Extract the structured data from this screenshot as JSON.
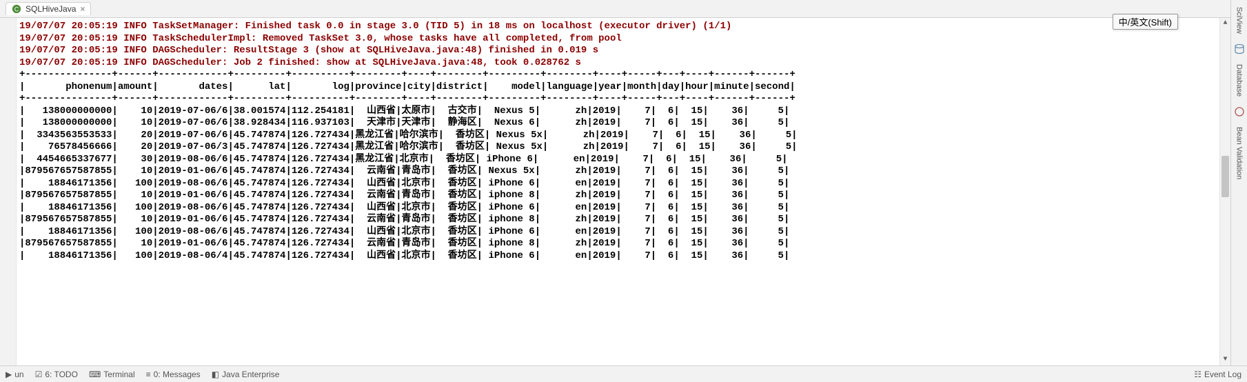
{
  "tab": {
    "title": "SQLHiveJava"
  },
  "ime": {
    "label": "中/英文(Shift)"
  },
  "logs": [
    "19/07/07 20:05:19 INFO TaskSetManager: Finished task 0.0 in stage 3.0 (TID 5) in 18 ms on localhost (executor driver) (1/1)",
    "19/07/07 20:05:19 INFO TaskSchedulerImpl: Removed TaskSet 3.0, whose tasks have all completed, from pool",
    "19/07/07 20:05:19 INFO DAGScheduler: ResultStage 3 (show at SQLHiveJava.java:48) finished in 0.019 s",
    "19/07/07 20:05:19 INFO DAGScheduler: Job 2 finished: show at SQLHiveJava.java:48, took 0.028762 s"
  ],
  "table": {
    "columns": [
      "phonenum",
      "amount",
      "dates",
      "lat",
      "log",
      "province",
      "city",
      "district",
      "model",
      "language",
      "year",
      "month",
      "day",
      "hour",
      "minute",
      "second"
    ],
    "rows": [
      [
        "138000000000",
        "10",
        "2019-07-06/6",
        "38.001574",
        "112.254181",
        "山西省",
        "太原市",
        "古交市",
        "Nexus 5",
        "zh",
        "2019",
        "7",
        "6",
        "15",
        "36",
        "5"
      ],
      [
        "138000000000",
        "10",
        "2019-07-06/6",
        "38.928434",
        "116.937103",
        "天津市",
        "天津市",
        "静海区",
        "Nexus 6",
        "zh",
        "2019",
        "7",
        "6",
        "15",
        "36",
        "5"
      ],
      [
        "3343563553533",
        "20",
        "2019-07-06/6",
        "45.747874",
        "126.727434",
        "黑龙江省",
        "哈尔滨市",
        "香坊区",
        "Nexus 5x",
        "zh",
        "2019",
        "7",
        "6",
        "15",
        "36",
        "5"
      ],
      [
        "76578456666",
        "20",
        "2019-07-06/3",
        "45.747874",
        "126.727434",
        "黑龙江省",
        "哈尔滨市",
        "香坊区",
        "Nexus 5x",
        "zh",
        "2019",
        "7",
        "6",
        "15",
        "36",
        "5"
      ],
      [
        "4454665337677",
        "30",
        "2019-08-06/6",
        "45.747874",
        "126.727434",
        "黑龙江省",
        "北京市",
        "香坊区",
        "iPhone 6",
        "en",
        "2019",
        "7",
        "6",
        "15",
        "36",
        "5"
      ],
      [
        "879567657587855",
        "10",
        "2019-01-06/6",
        "45.747874",
        "126.727434",
        "云南省",
        "青岛市",
        "香坊区",
        "Nexus 5x",
        "zh",
        "2019",
        "7",
        "6",
        "15",
        "36",
        "5"
      ],
      [
        "18846171356",
        "100",
        "2019-08-06/6",
        "45.747874",
        "126.727434",
        "山西省",
        "北京市",
        "香坊区",
        "iPhone 6",
        "en",
        "2019",
        "7",
        "6",
        "15",
        "36",
        "5"
      ],
      [
        "879567657587855",
        "10",
        "2019-01-06/6",
        "45.747874",
        "126.727434",
        "云南省",
        "青岛市",
        "香坊区",
        "iphone 8",
        "zh",
        "2019",
        "7",
        "6",
        "15",
        "36",
        "5"
      ],
      [
        "18846171356",
        "100",
        "2019-08-06/6",
        "45.747874",
        "126.727434",
        "山西省",
        "北京市",
        "香坊区",
        "iPhone 6",
        "en",
        "2019",
        "7",
        "6",
        "15",
        "36",
        "5"
      ],
      [
        "879567657587855",
        "10",
        "2019-01-06/6",
        "45.747874",
        "126.727434",
        "云南省",
        "青岛市",
        "香坊区",
        "iphone 8",
        "zh",
        "2019",
        "7",
        "6",
        "15",
        "36",
        "5"
      ],
      [
        "18846171356",
        "100",
        "2019-08-06/6",
        "45.747874",
        "126.727434",
        "山西省",
        "北京市",
        "香坊区",
        "iPhone 6",
        "en",
        "2019",
        "7",
        "6",
        "15",
        "36",
        "5"
      ],
      [
        "879567657587855",
        "10",
        "2019-01-06/6",
        "45.747874",
        "126.727434",
        "云南省",
        "青岛市",
        "香坊区",
        "iphone 8",
        "zh",
        "2019",
        "7",
        "6",
        "15",
        "36",
        "5"
      ],
      [
        "18846171356",
        "100",
        "2019-08-06/4",
        "45.747874",
        "126.727434",
        "山西省",
        "北京市",
        "香坊区",
        "iPhone 6",
        "en",
        "2019",
        "7",
        "6",
        "15",
        "36",
        "5"
      ]
    ],
    "widths": [
      15,
      6,
      12,
      9,
      10,
      8,
      4,
      8,
      9,
      8,
      4,
      5,
      3,
      4,
      6,
      6
    ]
  },
  "bottom": {
    "todo": "6: TODO",
    "terminal": "Terminal",
    "messages": "0: Messages",
    "java_ee": "Java Enterprise",
    "event_log": "Event Log"
  },
  "sidebar_right": {
    "items": [
      "SciView",
      "Database",
      "Bean Validation"
    ]
  }
}
